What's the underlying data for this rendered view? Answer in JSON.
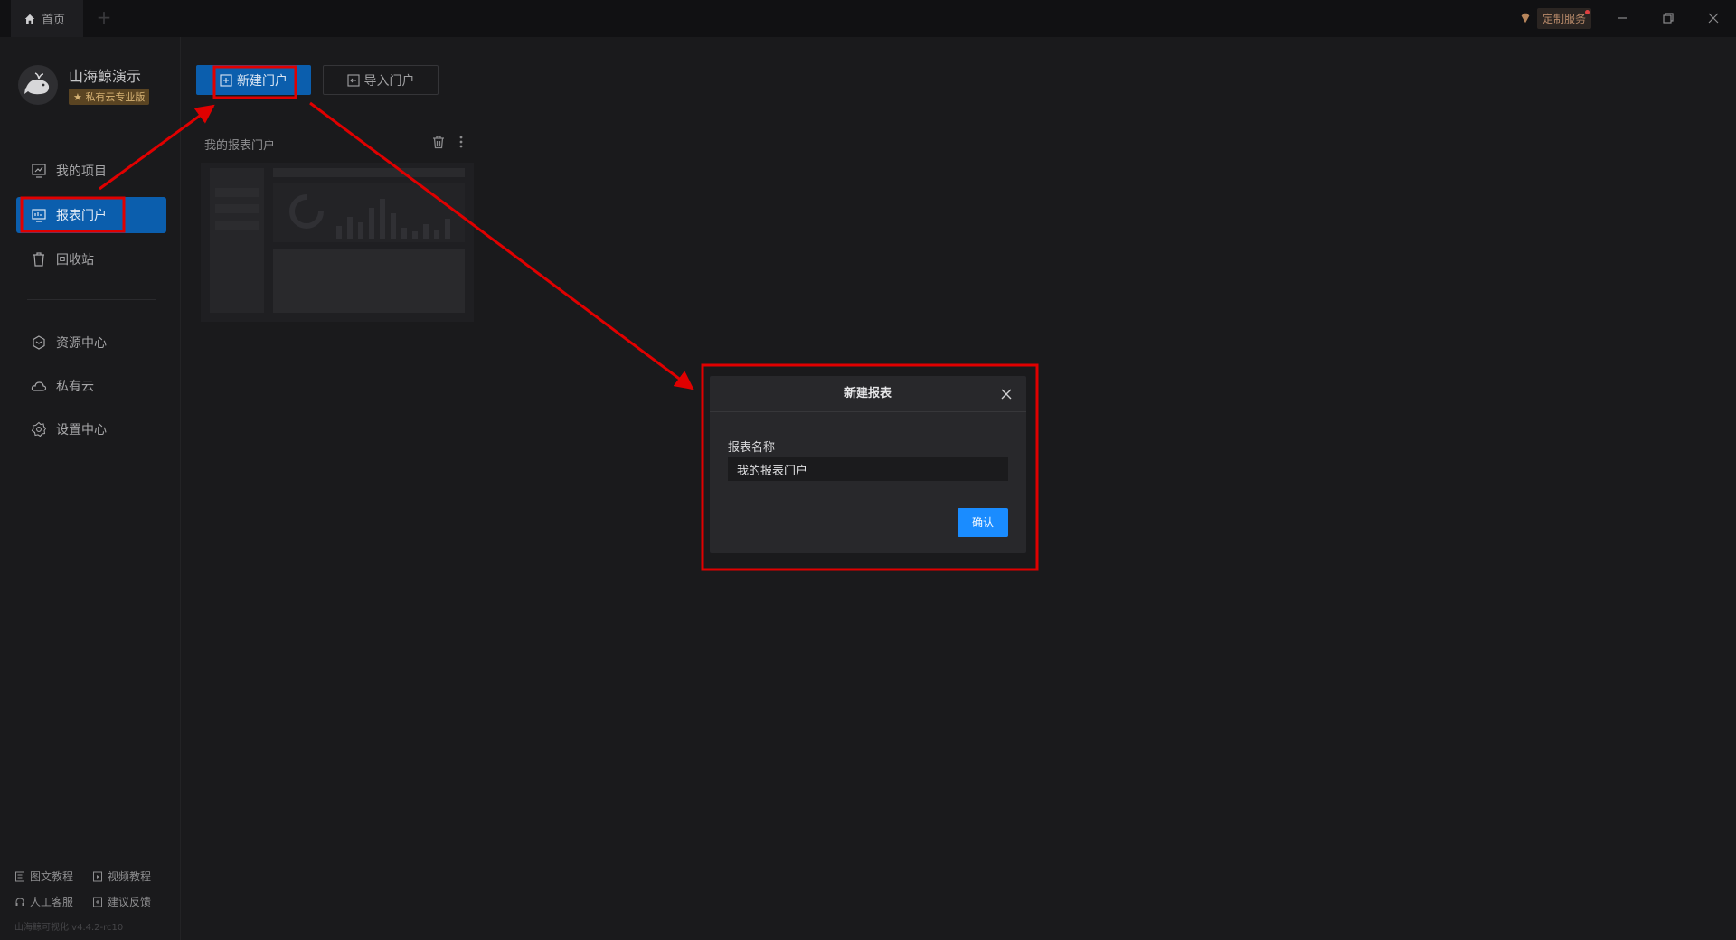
{
  "titlebar": {
    "home_tab": "首页",
    "add_tab": "+",
    "custom_service": "定制服务"
  },
  "profile": {
    "name": "山海鲸演示",
    "badge": "★ 私有云专业版"
  },
  "nav": {
    "my_projects": "我的项目",
    "report_portal": "报表门户",
    "recycle_bin": "回收站",
    "resource_center": "资源中心",
    "private_cloud": "私有云",
    "settings_center": "设置中心"
  },
  "help": {
    "text_tutorial": "图文教程",
    "video_tutorial": "视频教程",
    "customer_service": "人工客服",
    "feedback": "建议反馈"
  },
  "version": "山海鲸可视化 v4.4.2-rc10",
  "toolbar": {
    "new_portal": "新建门户",
    "import_portal": "导入门户"
  },
  "card": {
    "title": "我的报表门户"
  },
  "dialog": {
    "title": "新建报表",
    "field_label": "报表名称",
    "field_value": "我的报表门户",
    "confirm": "确认"
  },
  "colors": {
    "accent": "#0b5ead",
    "confirm": "#1a8cff",
    "annotation": "#e00000"
  }
}
